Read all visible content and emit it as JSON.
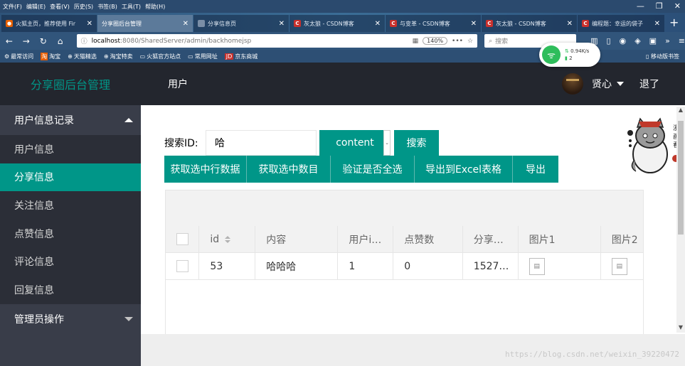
{
  "browser": {
    "menu": [
      "文件(F)",
      "编辑(E)",
      "查看(V)",
      "历史(S)",
      "书签(B)",
      "工具(T)",
      "帮助(H)"
    ],
    "tabs": [
      {
        "title": "火狐主页，推荐使用 Fir",
        "icon": "firefox-icon",
        "color": "#e66000",
        "letter": "●"
      },
      {
        "title": "分享圈后台管理",
        "icon": "page-icon",
        "color": "#5c7a9a",
        "letter": ""
      },
      {
        "title": "分享信息页",
        "icon": "page-icon",
        "color": "#7a8ea6",
        "letter": ""
      },
      {
        "title": "灰太狼 - CSDN博客",
        "icon": "csdn-icon",
        "color": "#c9302c",
        "letter": "C"
      },
      {
        "title": "与变革 - CSDN博客",
        "icon": "csdn-icon",
        "color": "#c9302c",
        "letter": "C"
      },
      {
        "title": "灰太狼 - CSDN博客",
        "icon": "csdn-icon",
        "color": "#c9302c",
        "letter": "C"
      },
      {
        "title": "编程题：幸运的袋子",
        "icon": "csdn-icon",
        "color": "#c9302c",
        "letter": "C"
      }
    ],
    "url_host": "localhost",
    "url_rest": ":8080/SharedServer/admin/backhomejsp",
    "zoom": "140%",
    "search_placeholder": "搜索",
    "bookmarks": [
      "最常访问",
      "淘宝",
      "天猫精选",
      "淘宝特卖",
      "火狐官方站点",
      "常用网址",
      "京东商城"
    ],
    "bookmark_right": "移动版书签",
    "wifi_speed": "0.94K/s",
    "wifi_count": "2"
  },
  "header": {
    "brand": "分享圈后台管理",
    "nav": "用户",
    "username": "贤心",
    "logout": "退了"
  },
  "sidebar": {
    "group1": "用户信息记录",
    "items": [
      "用户信息",
      "分享信息",
      "关注信息",
      "点赞信息",
      "评论信息",
      "回复信息"
    ],
    "active_index": 1,
    "group2": "管理员操作"
  },
  "search": {
    "label": "搜索ID:",
    "value": "哈",
    "field": "content",
    "button": "搜索"
  },
  "actions": [
    "获取选中行数据",
    "获取选中数目",
    "验证是否全选",
    "导出到Excel表格",
    "导出"
  ],
  "table": {
    "headers": [
      "id",
      "内容",
      "用户i…",
      "点赞数",
      "分享…",
      "图片1",
      "图片2"
    ],
    "rows": [
      [
        "53",
        "哈哈哈",
        "1",
        "0",
        "1527…"
      ]
    ]
  },
  "watermark": "https://blog.csdn.net/weixin_39220472"
}
